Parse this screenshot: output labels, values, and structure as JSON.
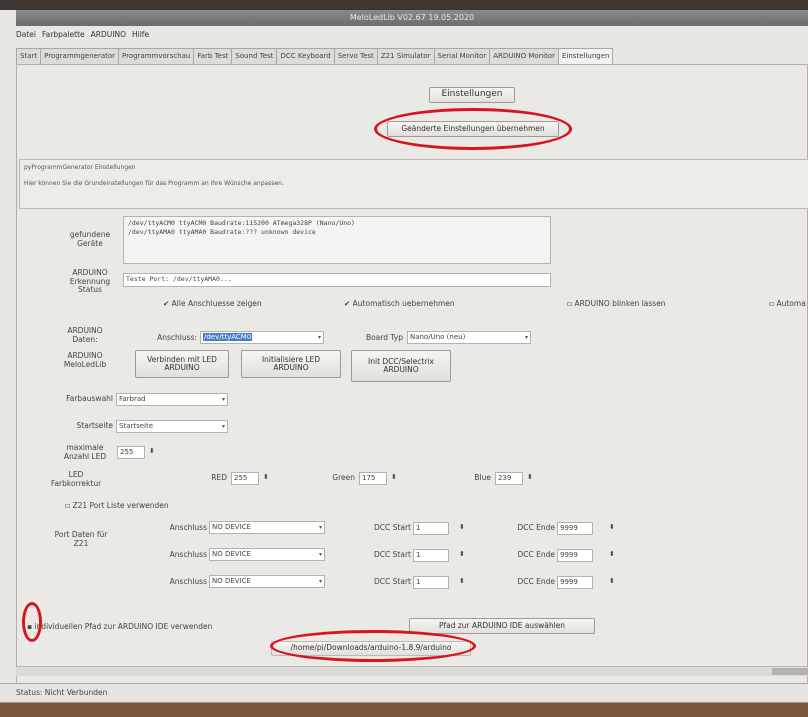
{
  "window": {
    "title": "MeloLedLib V02.67 19.05.2020"
  },
  "menu": [
    "Datei",
    "Farbpalette",
    "ARDUINO",
    "Hilfe"
  ],
  "tabs": [
    "Start",
    "Programmgenerator",
    "Programmvorschau",
    "Farb Test",
    "Sound Test",
    "DCC Keyboard",
    "Servo Test",
    "Z21 Simulator",
    "Serial Monitor",
    "ARDUINO Monitor",
    "Einstellungen"
  ],
  "active_tab": "Einstellungen",
  "settings": {
    "heading": "Einstellungen",
    "apply_button": "Geänderte Einstellungen übernehmen",
    "group_title": "pyProgrammGenerator Einstellungen",
    "group_description": "Hier können Sie die Grundeinstellungen für das Programm an Ihre Wünsche anpassen.",
    "devices_label": "gefundene Geräte",
    "devices_text": "/dev/ttyACM0 ttyACM0 Baudrate:115200 ATmega328P (Nano/Uno)\n/dev/ttyAMA0 ttyAMA0 Baudrate:??? unknown device",
    "detection_label": "ARDUINO Erkennung Status",
    "detection_text": "Teste Port: /dev/ttyAMA0...",
    "cb_all_ports": "Alle Anschluesse zeigen",
    "cb_auto_apply": "Automatisch uebernehmen",
    "cb_blink": "ARDUINO blinken lassen",
    "cb_auto_cut": "Automa",
    "arduino_data_label": "ARDUINO Daten:",
    "port_label": "Anschluss:",
    "port_value": "/dev/ttyACM0",
    "board_label": "Board Typ",
    "board_value": "Nano/Uno (neu)",
    "arduino_melo_label": "ARDUINO MeloLedLib",
    "btn_connect": "Verbinden mit LED ARDUINO",
    "btn_init_led": "Initialisiere LED ARDUINO",
    "btn_init_dcc": "Init DCC/Selectrix ARDUINO",
    "color_choice_label": "Farbauswahl",
    "color_choice_value": "Farbrad",
    "start_page_label": "Startseite",
    "start_page_value": "Startseite",
    "max_led_label": "maximale Anzahl LED",
    "max_led_value": "255",
    "led_corr_label": "LED Farbkorrektur",
    "red_label": "RED",
    "red_value": "255",
    "green_label": "Green",
    "green_value": "175",
    "blue_label": "Blue",
    "blue_value": "239",
    "z21_checkbox": "Z21 Port Liste verwenden",
    "port_data_label": "Port Daten für Z21",
    "z21_rows": [
      {
        "port_label": "Anschluss",
        "port": "NO DEVICE",
        "start_label": "DCC Start",
        "start": "1",
        "end_label": "DCC Ende",
        "end": "9999"
      },
      {
        "port_label": "Anschluss",
        "port": "NO DEVICE",
        "start_label": "DCC Start",
        "start": "1",
        "end_label": "DCC Ende",
        "end": "9999"
      },
      {
        "port_label": "Anschluss",
        "port": "NO DEVICE",
        "start_label": "DCC Start",
        "start": "1",
        "end_label": "DCC Ende",
        "end": "9999"
      }
    ],
    "ide_checkbox": "individuellen Pfad zur ARDUINO IDE verwenden",
    "ide_button": "Pfad zur ARDUINO IDE auswählen",
    "ide_path": "/home/pi/Downloads/arduino-1.8.9/arduino"
  },
  "status": "Status: Nicht Verbunden",
  "highlight_color": "#d8141e"
}
